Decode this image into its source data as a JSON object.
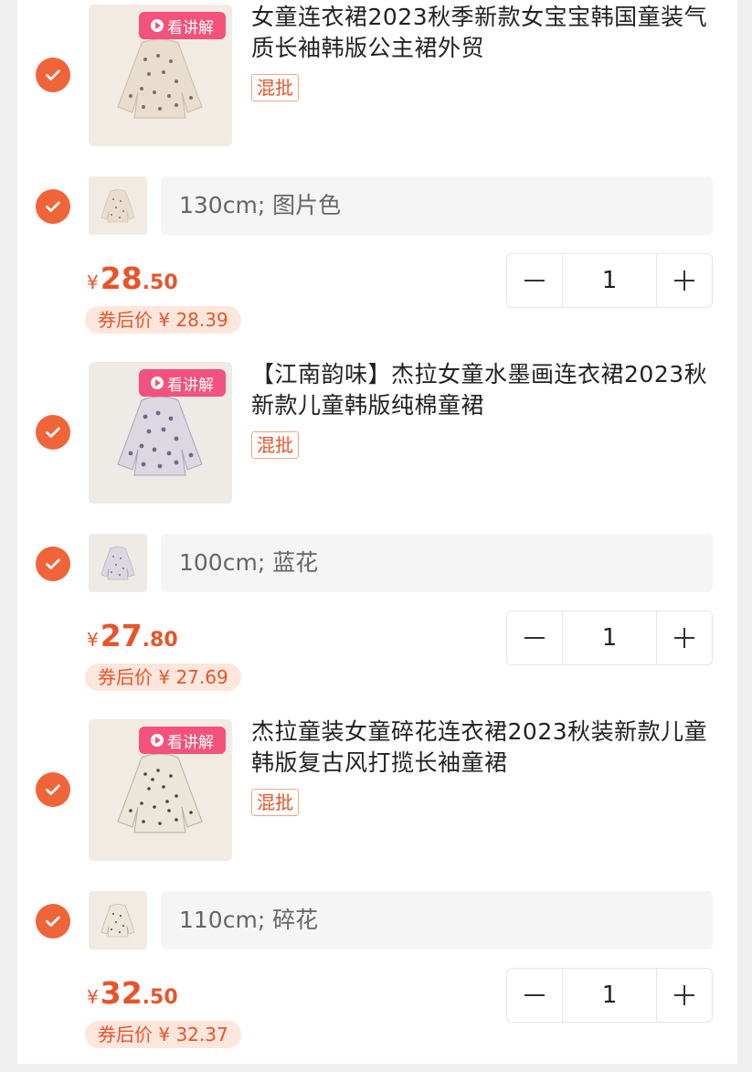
{
  "items": [
    {
      "video_label": "看讲解",
      "title": "女童连衣裙2023秋季新款女宝宝韩国童装气质长袖韩版公主裙外贸",
      "tag": "混批",
      "sku": "130cm; 图片色",
      "price": {
        "currency": "¥",
        "integer": "28",
        "decimal": ".50"
      },
      "coupon_label": "券后价",
      "coupon_price": "¥ 28.39",
      "quantity": "1",
      "checked": true
    },
    {
      "video_label": "看讲解",
      "title": "【江南韵味】杰拉女童水墨画连衣裙2023秋新款儿童韩版纯棉童裙",
      "tag": "混批",
      "sku": "100cm; 蓝花",
      "price": {
        "currency": "¥",
        "integer": "27",
        "decimal": ".80"
      },
      "coupon_label": "券后价",
      "coupon_price": "¥ 27.69",
      "quantity": "1",
      "checked": true
    },
    {
      "video_label": "看讲解",
      "title": "杰拉童装女童碎花连衣裙2023秋装新款儿童韩版复古风打揽长袖童裙",
      "tag": "混批",
      "sku": "110cm; 碎花",
      "price": {
        "currency": "¥",
        "integer": "32",
        "decimal": ".50"
      },
      "coupon_label": "券后价",
      "coupon_price": "¥ 32.37",
      "quantity": "1",
      "checked": true
    }
  ],
  "stepper": {
    "minus": "−",
    "plus": "+"
  },
  "colors": {
    "accent": "#f0643a",
    "price": "#e8542a",
    "video_badge": "#f2527c"
  },
  "icons": {
    "check": "check-icon",
    "play": "play-icon",
    "minus": "minus-icon",
    "plus": "plus-icon"
  }
}
